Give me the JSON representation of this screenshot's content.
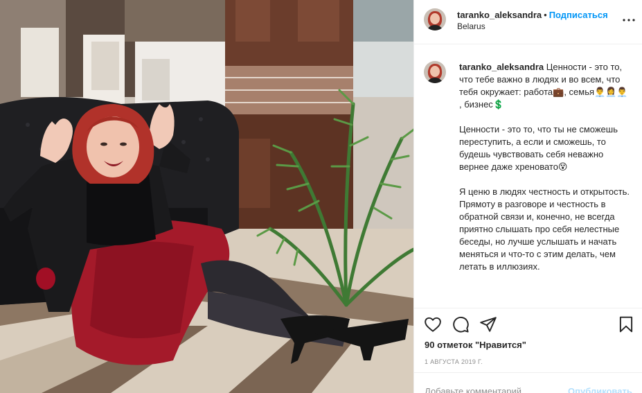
{
  "post": {
    "username": "taranko_aleksandra",
    "separator": "•",
    "follow_label": "Подписаться",
    "location": "Belarus",
    "more_icon": "more-horizontal-icon"
  },
  "caption": {
    "username": "taranko_aleksandra",
    "p1": " Ценности - это то, что тебе важно в людях и во всем, что тебя окружает: работа💼, семья👨‍💼👩‍💼👨‍💼 , бизнес💲",
    "p2": "Ценности - это то, что ты не сможешь переступить, а если и сможешь, то будешь чувствовать себя неважно вернее даже хреновато😵",
    "p3": "Я ценю в людях честность и открытость. Прямоту в разговоре и честность в обратной связи и, конечно, не всегда приятно слышать про себя нелестные беседы, но лучше услышать и начать меняться и что-то с этим делать, чем летать в иллюзиях."
  },
  "actions": {
    "like_icon": "heart-icon",
    "comment_icon": "comment-icon",
    "share_icon": "share-icon",
    "save_icon": "bookmark-icon",
    "likes_text": "90 отметок \"Нравится\"",
    "date": "1 АВГУСТА 2019 Г."
  },
  "comment": {
    "placeholder": "Добавьте комментарий...",
    "publish_label": "Опубликовать"
  },
  "colors": {
    "link": "#0095f6",
    "text": "#262626",
    "muted": "#8e8e8e",
    "publish_disabled": "#b2dffc"
  }
}
